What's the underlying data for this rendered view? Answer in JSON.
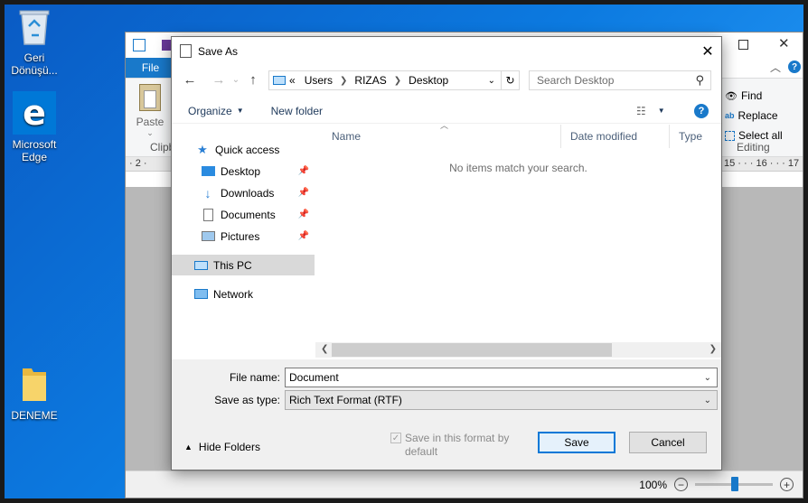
{
  "desktop": {
    "icons": [
      {
        "label": "Geri Dönüşü..."
      },
      {
        "label": "Microsoft Edge"
      },
      {
        "label": "DENEME"
      }
    ]
  },
  "wordpad": {
    "file_tab": "File",
    "paste_label": "Paste",
    "clipboard_label": "Clipb",
    "find_label": "Find",
    "replace_label": "Replace",
    "select_all_label": "Select all",
    "editing_label": "Editing",
    "ruler_left": "· 2 ·",
    "ruler_right": "15 · · · 16 · · · 17",
    "zoom": "100%",
    "zoom_level_percent": 100
  },
  "dialog": {
    "title": "Save As",
    "address": {
      "prefix": "«",
      "segments": [
        "Users",
        "RIZAS",
        "Desktop"
      ]
    },
    "search_placeholder": "Search Desktop",
    "toolbar": {
      "organize": "Organize",
      "new_folder": "New folder"
    },
    "nav": {
      "quick_access": "Quick access",
      "items": [
        {
          "label": "Desktop",
          "icon": "desktop-folder-icon"
        },
        {
          "label": "Downloads",
          "icon": "downloads-icon"
        },
        {
          "label": "Documents",
          "icon": "documents-icon"
        },
        {
          "label": "Pictures",
          "icon": "pictures-icon"
        }
      ],
      "this_pc": "This PC",
      "network": "Network"
    },
    "columns": [
      "Name",
      "Date modified",
      "Type"
    ],
    "empty_message": "No items match your search.",
    "file_name_label": "File name:",
    "file_name_value": "Document",
    "save_type_label": "Save as type:",
    "save_type_value": "Rich Text Format (RTF)",
    "save_format_checkbox": "Save in this format by default",
    "hide_folders": "Hide Folders",
    "save_button": "Save",
    "cancel_button": "Cancel"
  },
  "colors": {
    "accent": "#1979ca",
    "focus_border": "#0078d7",
    "desktop_blue": "#0c7ae0"
  }
}
